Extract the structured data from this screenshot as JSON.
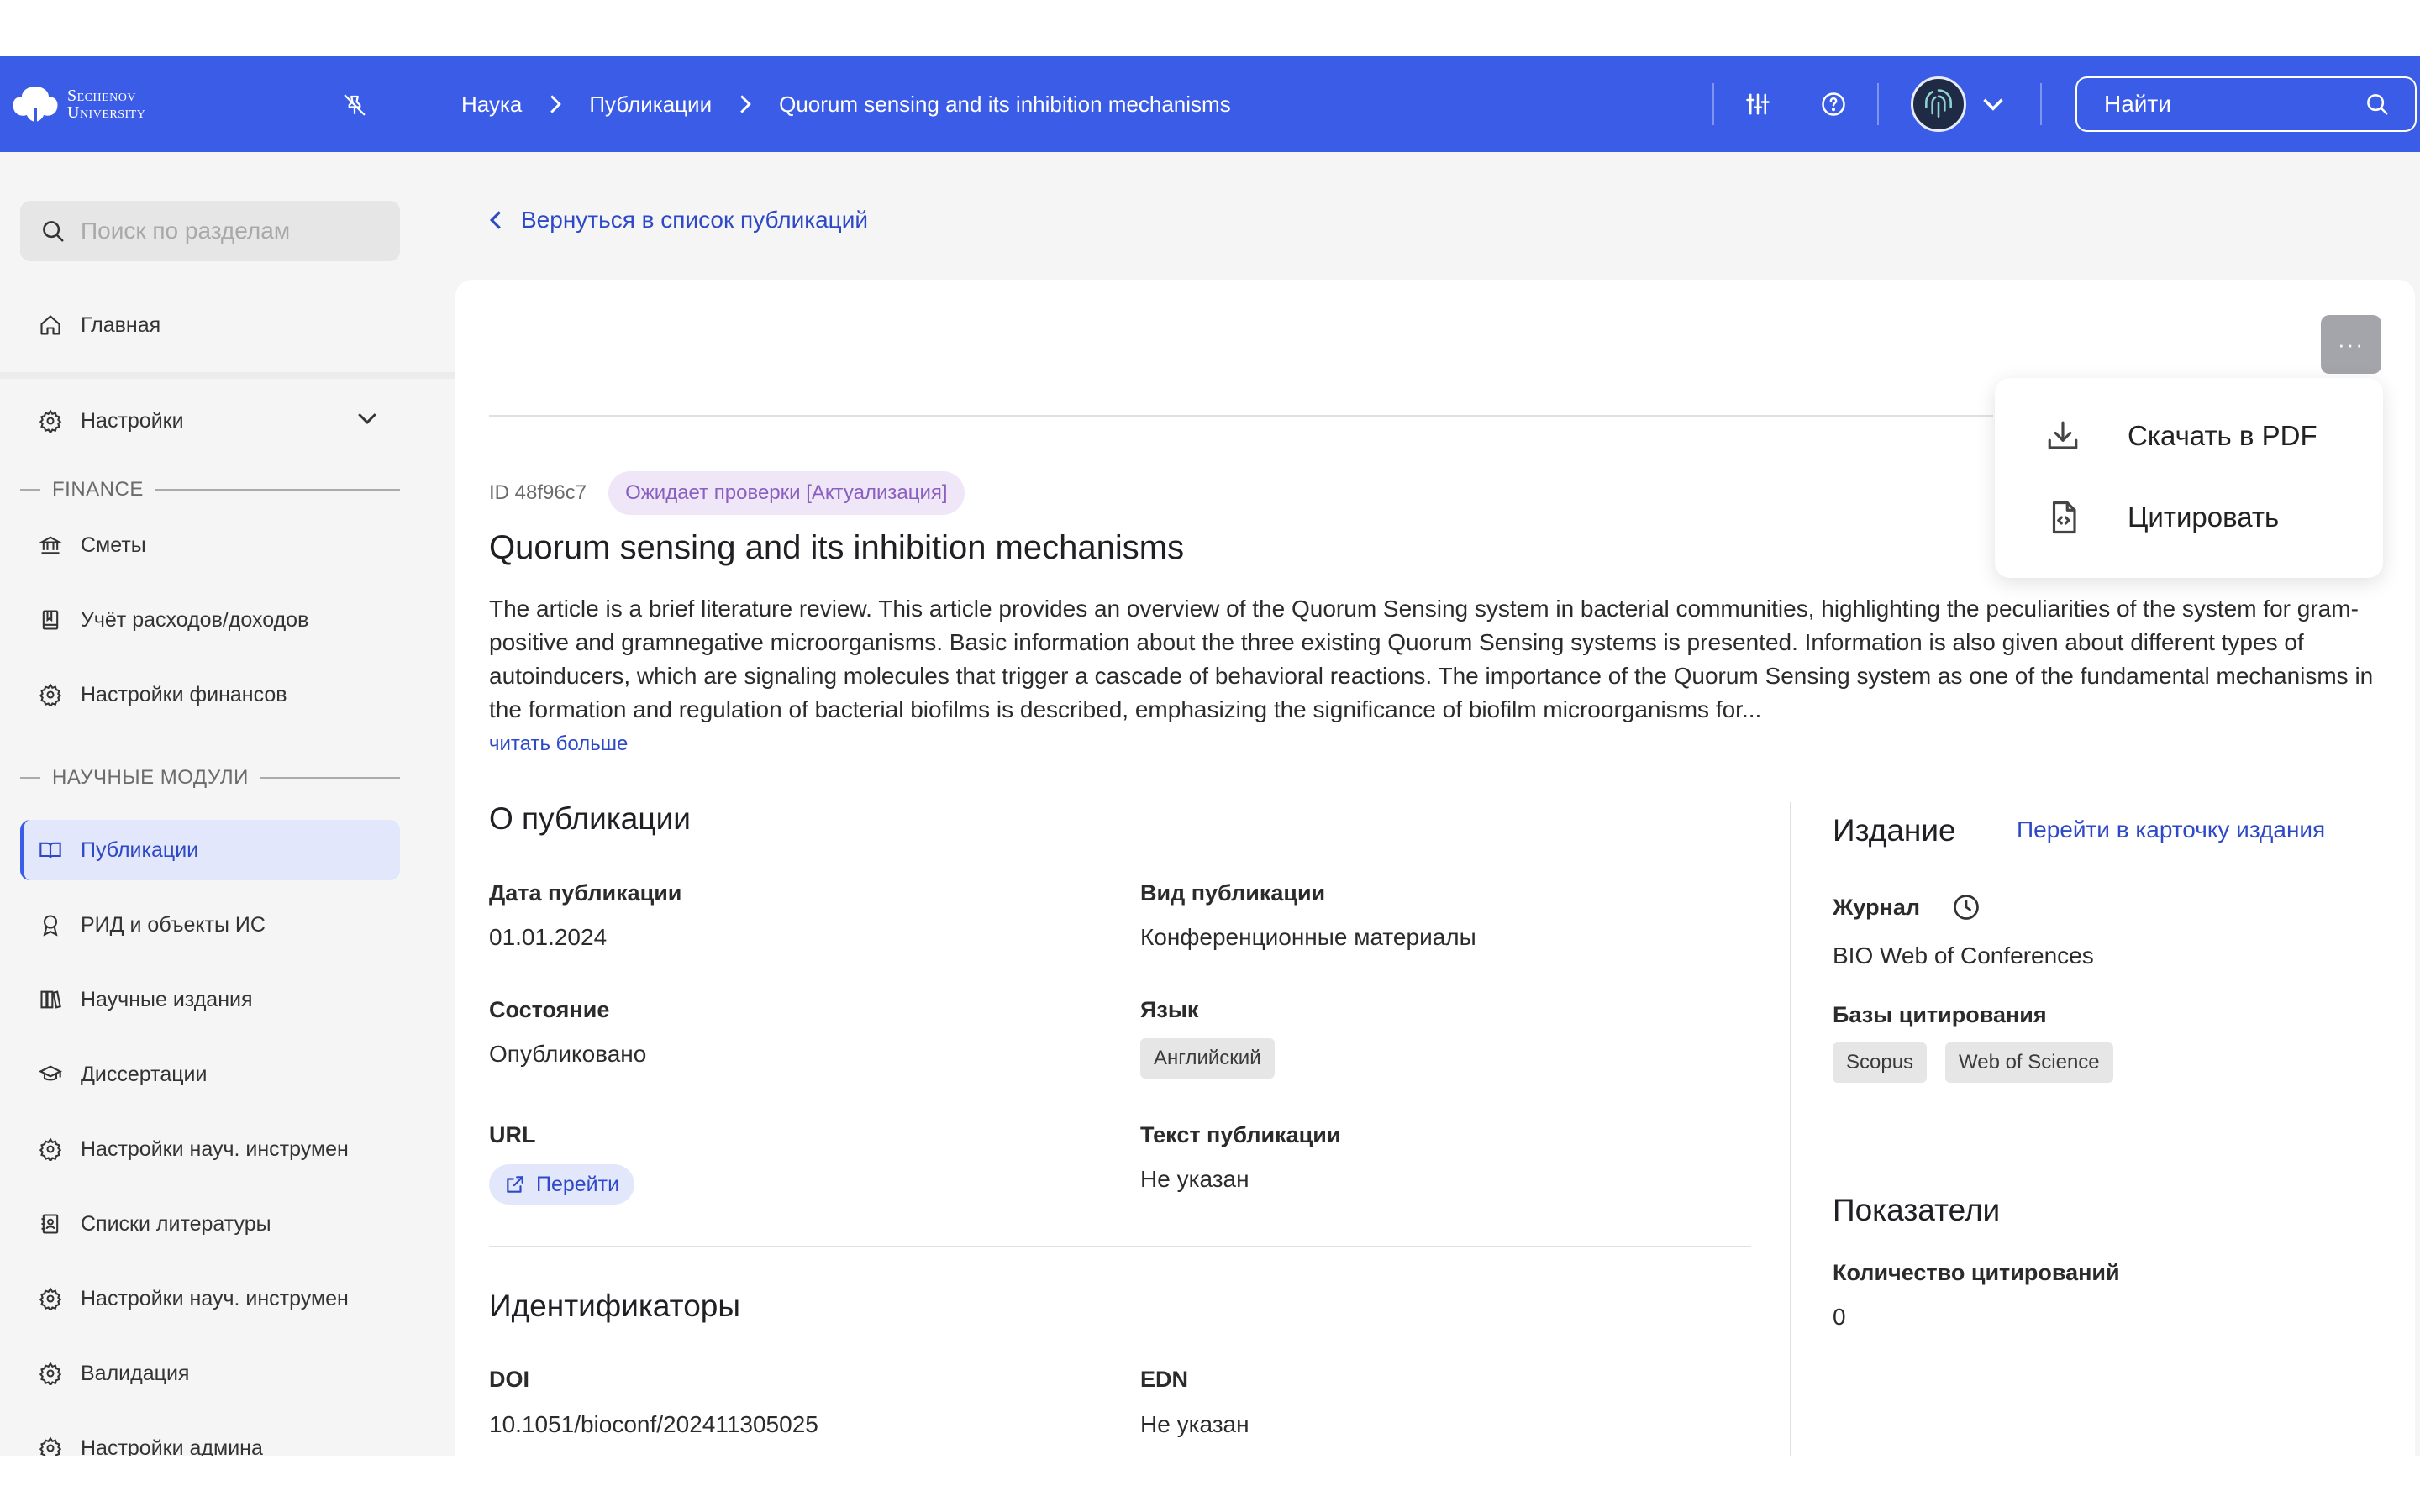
{
  "colors": {
    "brand": "#3b5ce6",
    "accent_text": "#2d49c7",
    "status_badge_bg": "#efe6f8",
    "status_badge_text": "#8a5fc0"
  },
  "header": {
    "logo_line1": "Sechenov",
    "logo_line2": "University",
    "breadcrumb": [
      "Наука",
      "Публикации",
      "Quorum sensing and its inhibition mechanisms"
    ],
    "search_placeholder": "Найти",
    "icons": [
      "pin-off-icon",
      "filter-sliders-icon",
      "help-circle-icon",
      "chevron-down-icon",
      "search-icon"
    ]
  },
  "sidebar": {
    "search_placeholder": "Поиск по разделам",
    "home": "Главная",
    "settings": "Настройки",
    "section_finance": "FINANCE",
    "finance_items": [
      "Сметы",
      "Учёт расходов/доходов",
      "Настройки финансов"
    ],
    "section_science": "НАУЧНЫЕ МОДУЛИ",
    "science_items": [
      "Публикации",
      "РИД и объекты ИС",
      "Научные издания",
      "Диссертации",
      "Настройки науч. инструмен",
      "Списки литературы",
      "Настройки науч. инструмен",
      "Валидация",
      "Настройки админа"
    ],
    "active_item": "Публикации"
  },
  "main": {
    "back_label": "Вернуться в список публикаций",
    "more_button": "···",
    "dropdown": {
      "download_pdf": "Скачать в PDF",
      "cite": "Цитировать"
    },
    "id_label": "ID 48f96c7",
    "status": "Ожидает проверки [Актуализация]",
    "title": "Quorum sensing and its inhibition mechanisms",
    "abstract": "The article is a brief literature review. This article provides an overview of the Quorum Sensing system in bacterial communities, highlighting the peculiarities of the system for gram-positive and gramnegative microorganisms. Basic information about the three existing Quorum Sensing systems is presented. Information is also given about different types of autoinducers, which are signaling molecules that trigger a cascade of behavioral reactions. The importance of the Quorum Sensing system as one of the fundamental mechanisms in the formation and regulation of bacterial biofilms is described, emphasizing the significance of biofilm microorganisms for...",
    "read_more": "читать больше",
    "about": {
      "heading": "О публикации",
      "pub_date_label": "Дата публикации",
      "pub_date": "01.01.2024",
      "pub_type_label": "Вид публикации",
      "pub_type": "Конференционные материалы",
      "state_label": "Состояние",
      "state": "Опубликовано",
      "language_label": "Язык",
      "language": "Английский",
      "url_label": "URL",
      "url_link": "Перейти",
      "text_label": "Текст публикации",
      "text_value": "Не указан"
    },
    "identifiers": {
      "heading": "Идентификаторы",
      "doi_label": "DOI",
      "doi": "10.1051/bioconf/202411305025",
      "edn_label": "EDN",
      "edn": "Не указан"
    },
    "edition": {
      "heading": "Издание",
      "link": "Перейти в карточку издания",
      "journal_label": "Журнал",
      "journal": "BIO Web of Conferences",
      "citation_db_label": "Базы цитирования",
      "citation_dbs": [
        "Scopus",
        "Web of Science"
      ]
    },
    "metrics": {
      "heading": "Показатели",
      "citations_label": "Количество цитирований",
      "citations": "0"
    }
  }
}
